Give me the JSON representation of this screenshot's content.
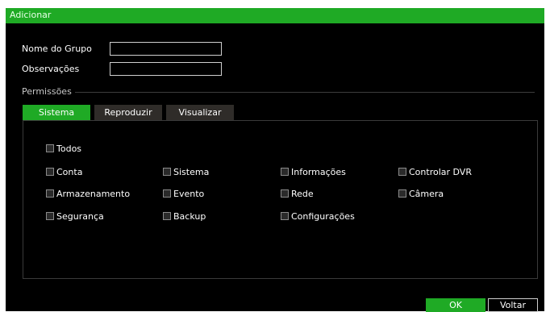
{
  "window": {
    "title": "Adicionar"
  },
  "form": {
    "group_name_label": "Nome do Grupo",
    "group_name_value": "",
    "notes_label": "Observações",
    "notes_value": ""
  },
  "permissions": {
    "section_label": "Permissões",
    "tabs": [
      {
        "label": "Sistema",
        "active": true
      },
      {
        "label": "Reproduzir",
        "active": false
      },
      {
        "label": "Visualizar",
        "active": false
      }
    ],
    "all_label": "Todos",
    "all_checked": false,
    "items": [
      {
        "label": "Conta",
        "checked": false
      },
      {
        "label": "Sistema",
        "checked": false
      },
      {
        "label": "Informações",
        "checked": false
      },
      {
        "label": "Controlar DVR",
        "checked": false
      },
      {
        "label": "Armazenamento",
        "checked": false
      },
      {
        "label": "Evento",
        "checked": false
      },
      {
        "label": "Rede",
        "checked": false
      },
      {
        "label": "Câmera",
        "checked": false
      },
      {
        "label": "Segurança",
        "checked": false
      },
      {
        "label": "Backup",
        "checked": false
      },
      {
        "label": "Configurações",
        "checked": false
      }
    ]
  },
  "buttons": {
    "ok_label": "OK",
    "back_label": "Voltar"
  },
  "colors": {
    "accent": "#1faa25",
    "background": "#000000",
    "tab_inactive": "#2f2c29"
  }
}
